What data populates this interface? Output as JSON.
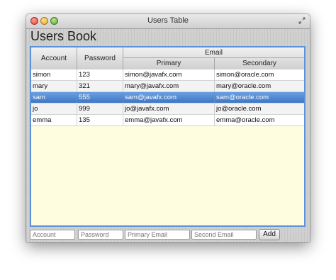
{
  "window": {
    "title": "Users Table"
  },
  "heading": "Users Book",
  "table": {
    "columns": {
      "account": "Account",
      "password": "Password",
      "email": "Email",
      "primary": "Primary",
      "secondary": "Secondary"
    },
    "rows": [
      {
        "account": "simon",
        "password": "123",
        "primary": "simon@javafx.com",
        "secondary": "simon@oracle.com"
      },
      {
        "account": "mary",
        "password": "321",
        "primary": "mary@javafx.com",
        "secondary": "mary@oracle.com"
      },
      {
        "account": "sam",
        "password": "555",
        "primary": "sam@javafx.com",
        "secondary": "sam@oracle.com"
      },
      {
        "account": "jo",
        "password": "999",
        "primary": "jo@javafx.com",
        "secondary": "jo@oracle.com"
      },
      {
        "account": "emma",
        "password": "135",
        "primary": "emma@javafx.com",
        "secondary": "emma@oracle.com"
      }
    ],
    "selected_row": 2
  },
  "form": {
    "account_placeholder": "Account",
    "password_placeholder": "Password",
    "primary_placeholder": "Primary Email",
    "second_placeholder": "Second Email",
    "add_label": "Add"
  },
  "colors": {
    "selection": "#4a80cc",
    "table_focus_border": "#5a93d8",
    "empty_area": "#fffde0"
  }
}
